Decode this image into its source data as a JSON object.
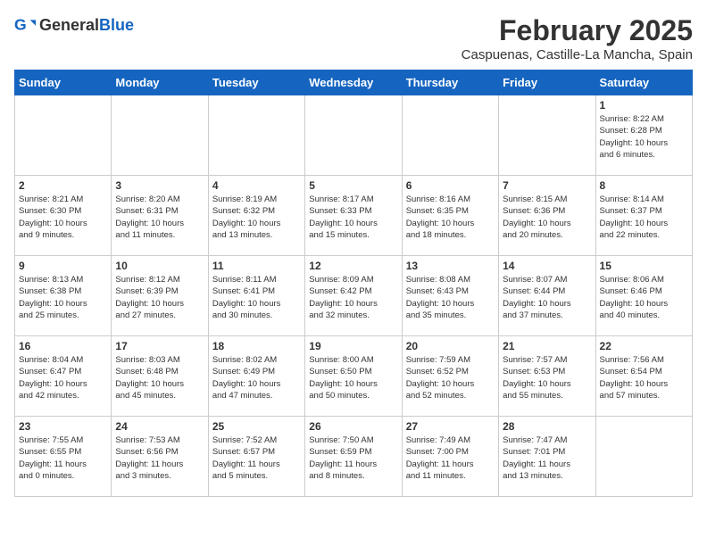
{
  "header": {
    "logo_general": "General",
    "logo_blue": "Blue",
    "month_title": "February 2025",
    "location": "Caspuenas, Castille-La Mancha, Spain"
  },
  "weekdays": [
    "Sunday",
    "Monday",
    "Tuesday",
    "Wednesday",
    "Thursday",
    "Friday",
    "Saturday"
  ],
  "weeks": [
    [
      {
        "day": "",
        "info": ""
      },
      {
        "day": "",
        "info": ""
      },
      {
        "day": "",
        "info": ""
      },
      {
        "day": "",
        "info": ""
      },
      {
        "day": "",
        "info": ""
      },
      {
        "day": "",
        "info": ""
      },
      {
        "day": "1",
        "info": "Sunrise: 8:22 AM\nSunset: 6:28 PM\nDaylight: 10 hours\nand 6 minutes."
      }
    ],
    [
      {
        "day": "2",
        "info": "Sunrise: 8:21 AM\nSunset: 6:30 PM\nDaylight: 10 hours\nand 9 minutes."
      },
      {
        "day": "3",
        "info": "Sunrise: 8:20 AM\nSunset: 6:31 PM\nDaylight: 10 hours\nand 11 minutes."
      },
      {
        "day": "4",
        "info": "Sunrise: 8:19 AM\nSunset: 6:32 PM\nDaylight: 10 hours\nand 13 minutes."
      },
      {
        "day": "5",
        "info": "Sunrise: 8:17 AM\nSunset: 6:33 PM\nDaylight: 10 hours\nand 15 minutes."
      },
      {
        "day": "6",
        "info": "Sunrise: 8:16 AM\nSunset: 6:35 PM\nDaylight: 10 hours\nand 18 minutes."
      },
      {
        "day": "7",
        "info": "Sunrise: 8:15 AM\nSunset: 6:36 PM\nDaylight: 10 hours\nand 20 minutes."
      },
      {
        "day": "8",
        "info": "Sunrise: 8:14 AM\nSunset: 6:37 PM\nDaylight: 10 hours\nand 22 minutes."
      }
    ],
    [
      {
        "day": "9",
        "info": "Sunrise: 8:13 AM\nSunset: 6:38 PM\nDaylight: 10 hours\nand 25 minutes."
      },
      {
        "day": "10",
        "info": "Sunrise: 8:12 AM\nSunset: 6:39 PM\nDaylight: 10 hours\nand 27 minutes."
      },
      {
        "day": "11",
        "info": "Sunrise: 8:11 AM\nSunset: 6:41 PM\nDaylight: 10 hours\nand 30 minutes."
      },
      {
        "day": "12",
        "info": "Sunrise: 8:09 AM\nSunset: 6:42 PM\nDaylight: 10 hours\nand 32 minutes."
      },
      {
        "day": "13",
        "info": "Sunrise: 8:08 AM\nSunset: 6:43 PM\nDaylight: 10 hours\nand 35 minutes."
      },
      {
        "day": "14",
        "info": "Sunrise: 8:07 AM\nSunset: 6:44 PM\nDaylight: 10 hours\nand 37 minutes."
      },
      {
        "day": "15",
        "info": "Sunrise: 8:06 AM\nSunset: 6:46 PM\nDaylight: 10 hours\nand 40 minutes."
      }
    ],
    [
      {
        "day": "16",
        "info": "Sunrise: 8:04 AM\nSunset: 6:47 PM\nDaylight: 10 hours\nand 42 minutes."
      },
      {
        "day": "17",
        "info": "Sunrise: 8:03 AM\nSunset: 6:48 PM\nDaylight: 10 hours\nand 45 minutes."
      },
      {
        "day": "18",
        "info": "Sunrise: 8:02 AM\nSunset: 6:49 PM\nDaylight: 10 hours\nand 47 minutes."
      },
      {
        "day": "19",
        "info": "Sunrise: 8:00 AM\nSunset: 6:50 PM\nDaylight: 10 hours\nand 50 minutes."
      },
      {
        "day": "20",
        "info": "Sunrise: 7:59 AM\nSunset: 6:52 PM\nDaylight: 10 hours\nand 52 minutes."
      },
      {
        "day": "21",
        "info": "Sunrise: 7:57 AM\nSunset: 6:53 PM\nDaylight: 10 hours\nand 55 minutes."
      },
      {
        "day": "22",
        "info": "Sunrise: 7:56 AM\nSunset: 6:54 PM\nDaylight: 10 hours\nand 57 minutes."
      }
    ],
    [
      {
        "day": "23",
        "info": "Sunrise: 7:55 AM\nSunset: 6:55 PM\nDaylight: 11 hours\nand 0 minutes."
      },
      {
        "day": "24",
        "info": "Sunrise: 7:53 AM\nSunset: 6:56 PM\nDaylight: 11 hours\nand 3 minutes."
      },
      {
        "day": "25",
        "info": "Sunrise: 7:52 AM\nSunset: 6:57 PM\nDaylight: 11 hours\nand 5 minutes."
      },
      {
        "day": "26",
        "info": "Sunrise: 7:50 AM\nSunset: 6:59 PM\nDaylight: 11 hours\nand 8 minutes."
      },
      {
        "day": "27",
        "info": "Sunrise: 7:49 AM\nSunset: 7:00 PM\nDaylight: 11 hours\nand 11 minutes."
      },
      {
        "day": "28",
        "info": "Sunrise: 7:47 AM\nSunset: 7:01 PM\nDaylight: 11 hours\nand 13 minutes."
      },
      {
        "day": "",
        "info": ""
      }
    ]
  ]
}
